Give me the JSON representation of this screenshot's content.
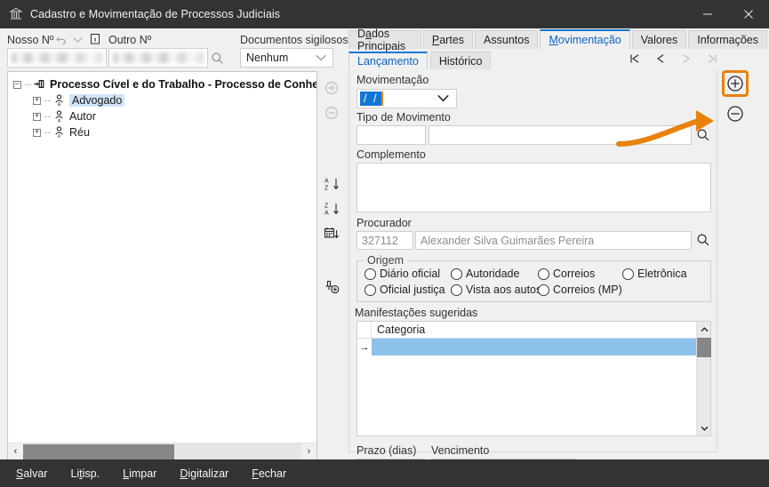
{
  "window": {
    "title": "Cadastro e Movimentação de Processos Judiciais",
    "app_icon": "court-building-icon",
    "minimize_label": "—",
    "close_label": "✕"
  },
  "header": {
    "nosso_numero_label": "Nosso Nº",
    "nosso_numero_value": "",
    "undo_icon": "undo-arrow-icon",
    "dropdown_icon": "chevron-down-icon",
    "info_icon": "info-icon",
    "outro_numero_label": "Outro Nº",
    "outro_numero_value": "",
    "search_icon": "magnifier-icon",
    "documentos_sigilosos_label": "Documentos sigilosos",
    "documentos_sigilosos_value": "Nenhum",
    "documentos_sigilosos_chevron": "chevron-down-icon"
  },
  "tree": {
    "nodes": [
      {
        "label": "Processo Cível e do Trabalho - Processo de Conhecimento",
        "expander": "−",
        "icon": "process-node-icon",
        "level": 0,
        "bold": true,
        "selected": false
      },
      {
        "label": "Advogado",
        "expander": "+",
        "icon": "person-r-icon",
        "level": 1,
        "bold": false,
        "selected": true
      },
      {
        "label": "Autor",
        "expander": "+",
        "icon": "person-a-icon",
        "level": 1,
        "bold": false,
        "selected": false
      },
      {
        "label": "Réu",
        "expander": "+",
        "icon": "person-p-icon",
        "level": 1,
        "bold": false,
        "selected": false
      }
    ],
    "hscroll": {
      "left_arrow": "‹",
      "right_arrow": "›"
    }
  },
  "sidetools": [
    {
      "name": "add-party-button",
      "icon": "plus-circle-icon",
      "enabled": false
    },
    {
      "name": "remove-party-button",
      "icon": "minus-circle-icon",
      "enabled": false
    },
    {
      "name": "sort-az-button",
      "icon": "sort-a-z-icon",
      "enabled": true
    },
    {
      "name": "sort-za-button",
      "icon": "sort-z-a-icon",
      "enabled": true
    },
    {
      "name": "sort-date-button",
      "icon": "sort-calendar-icon",
      "enabled": true
    },
    {
      "name": "add-attachment-button",
      "icon": "pin-plus-icon",
      "enabled": true
    }
  ],
  "tabs": [
    {
      "label": "Dados Principais",
      "accel": "a",
      "active": false
    },
    {
      "label": "Partes",
      "accel": "P",
      "active": false
    },
    {
      "label": "Assuntos",
      "accel": "",
      "active": false
    },
    {
      "label": "Movimentação",
      "accel": "M",
      "active": true
    },
    {
      "label": "Valores",
      "accel": "",
      "active": false
    },
    {
      "label": "Informações",
      "accel": "",
      "active": false
    }
  ],
  "subtabs": [
    {
      "label": "Lançamento",
      "active": true
    },
    {
      "label": "Histórico",
      "active": false
    }
  ],
  "record_nav": [
    {
      "name": "first-record-button",
      "icon": "nav-first-icon",
      "enabled": true
    },
    {
      "name": "previous-record-button",
      "icon": "nav-previous-icon",
      "enabled": true
    },
    {
      "name": "next-record-button",
      "icon": "nav-next-icon",
      "enabled": false
    },
    {
      "name": "last-record-button",
      "icon": "nav-last-icon",
      "enabled": false
    }
  ],
  "form": {
    "movimentacao_label": "Movimentação",
    "movimentacao_value": "/  /",
    "movimentacao_chevron": "chevron-down-icon",
    "tipo_movimento_label": "Tipo de Movimento",
    "tipo_movimento_code": "",
    "tipo_movimento_desc": "",
    "tipo_movimento_search_icon": "magnifier-icon",
    "complemento_label": "Complemento",
    "complemento_value": "",
    "procurador_label": "Procurador",
    "procurador_code": "327112",
    "procurador_name": "Alexander Silva Guimarães Pereira",
    "procurador_search_icon": "magnifier-icon",
    "origem_label": "Origem",
    "origem_options": [
      {
        "label": "Diário oficial",
        "checked": false
      },
      {
        "label": "Autoridade",
        "checked": false
      },
      {
        "label": "Correios",
        "checked": false
      },
      {
        "label": "Eletrônica",
        "checked": false
      },
      {
        "label": "Oficial justiça",
        "checked": false
      },
      {
        "label": "Vista aos autos",
        "checked": false
      },
      {
        "label": "Correios (MP)",
        "checked": false
      }
    ],
    "manifestacoes_label": "Manifestações sugeridas",
    "manifestacoes_column": "Categoria",
    "manifestacoes_rows": [
      {
        "categoria": "",
        "selected": true,
        "indicator": "→"
      }
    ],
    "manifestacoes_scroll_up": "⌃",
    "manifestacoes_scroll_down": "⌄",
    "prazo_label": "Prazo (dias)",
    "prazo_value": "",
    "vencimento_label": "Vencimento",
    "vencimento_value": "/  /",
    "vencimento_chevron": "chevron-down-icon"
  },
  "edge_buttons": [
    {
      "name": "add-movement-button",
      "icon": "plus-circle-icon",
      "highlighted": true
    },
    {
      "name": "remove-movement-button",
      "icon": "minus-circle-icon",
      "highlighted": false
    }
  ],
  "annotation": {
    "shape": "curved-arrow",
    "color": "#e8820c",
    "points_to": "add-movement-button"
  },
  "footer": {
    "buttons": [
      {
        "label": "Salvar",
        "accel": "S"
      },
      {
        "label": "Litisp.",
        "accel": "t"
      },
      {
        "label": "Limpar",
        "accel": "L"
      },
      {
        "label": "Digitalizar",
        "accel": "D"
      },
      {
        "label": "Fechar",
        "accel": "F"
      }
    ]
  },
  "colors": {
    "titlebar": "#333333",
    "accent_blue": "#1277d4",
    "annotation_orange": "#e8820c",
    "selection_blue": "#8dc2eb"
  }
}
